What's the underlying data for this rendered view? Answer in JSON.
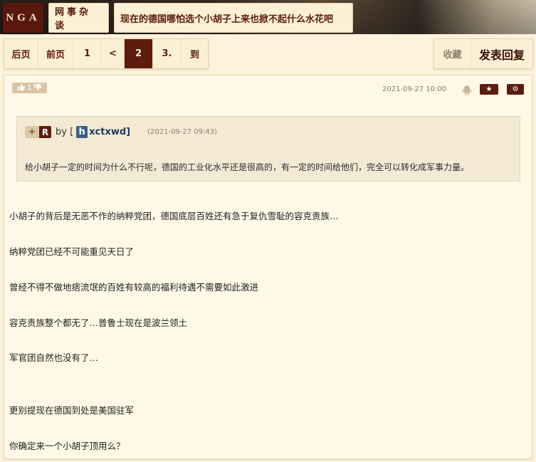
{
  "header": {
    "logo": "NGA",
    "forum": "网事杂谈",
    "topic": "现在的德国哪怕选个小胡子上来也掀不起什么水花吧"
  },
  "pager": {
    "items": [
      {
        "label": "后页",
        "active": false
      },
      {
        "label": "前页",
        "active": false
      },
      {
        "label": "1",
        "active": false
      },
      {
        "label": "<",
        "active": false
      },
      {
        "label": "2",
        "active": true
      },
      {
        "label": "3.",
        "active": false
      },
      {
        "label": "到",
        "active": false
      }
    ]
  },
  "actions": {
    "favorite": "收藏",
    "reply": "发表回复"
  },
  "post": {
    "likes": "1",
    "date": "2021-09-27 10:00",
    "quote": {
      "plus": "+",
      "rank": "R",
      "by": "by [",
      "user_initial": "h",
      "user_rest": "xctxwd]",
      "time": "(2021-09-27 09:43)",
      "text": "给小胡子一定的时间为什么不行呢，德国的工业化水平还是很高的，有一定的时间给他们，完全可以转化成军事力量。"
    },
    "lines": [
      "小胡子的背后是无恶不作的纳粹党团，德国底层百姓还有急于复仇雪耻的容克贵族…",
      "纳粹党团已经不可能重见天日了",
      "曾经不得不做地痞流氓的百姓有较高的福利待遇不需要如此激进",
      "容克贵族整个都无了…普鲁士现在是波兰领土",
      "军官团自然也没有了…",
      "更别提现在德国到处是美国驻军",
      "你确定来一个小胡子顶用么？"
    ]
  },
  "colors": {
    "brand": "#5e1c0d",
    "background": "#fdf3dc",
    "link": "#3b5f8c"
  }
}
